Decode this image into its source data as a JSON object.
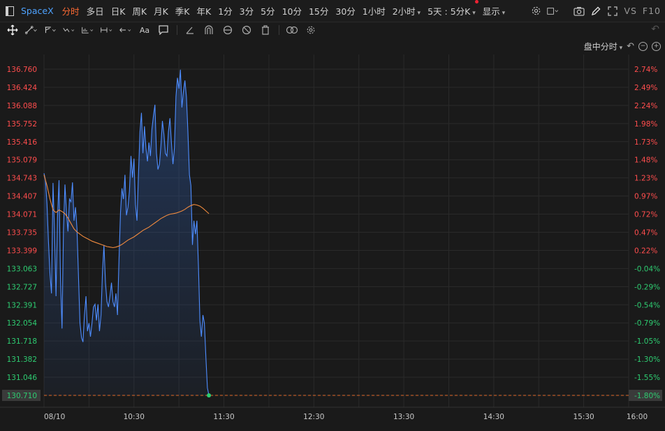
{
  "toolbar": {
    "symbol": "SpaceX",
    "intervals": [
      "分时",
      "多日",
      "日K",
      "周K",
      "月K",
      "季K",
      "年K",
      "1分",
      "3分",
      "5分",
      "10分",
      "15分",
      "30分",
      "1小时"
    ],
    "more_interval": "2小时",
    "multi_day": "5天 : 5分K",
    "display": "显示",
    "vs": "VS",
    "f10": "F10"
  },
  "period_bar": {
    "label": "盘中分时"
  },
  "colors": {
    "up": "#ff4d4d",
    "down": "#2ecc71",
    "price": "#4e8dff",
    "avg": "#f08a3e",
    "grid": "#2a2a2a",
    "background": "#1a1a1a"
  },
  "chart_data": {
    "type": "line",
    "title": "",
    "xlabel": "",
    "ylabel": "",
    "x_tick_labels": [
      "08/10",
      "10:30",
      "11:30",
      "12:30",
      "13:30",
      "14:30",
      "15:30",
      "16:00"
    ],
    "y_ticks_price": [
      "136.760",
      "136.424",
      "136.088",
      "135.752",
      "135.416",
      "135.079",
      "134.743",
      "134.407",
      "134.071",
      "133.735",
      "133.399",
      "133.063",
      "132.727",
      "132.391",
      "132.054",
      "131.718",
      "131.382",
      "131.046",
      "130.710"
    ],
    "y_ticks_pct": [
      "2.74%",
      "2.49%",
      "2.24%",
      "1.98%",
      "1.73%",
      "1.48%",
      "1.23%",
      "0.97%",
      "0.72%",
      "0.47%",
      "0.22%",
      "-0.04%",
      "-0.29%",
      "-0.54%",
      "-0.79%",
      "-1.05%",
      "-1.30%",
      "-1.55%",
      "-1.80%"
    ],
    "ylim": [
      130.71,
      136.76
    ],
    "reference_price": 133.11,
    "current_price": "130.710",
    "current_pct": "-1.80%",
    "time_range_minutes": [
      0,
      390
    ],
    "series": [
      {
        "name": "",
        "values": [
          [
            0,
            134.83
          ],
          [
            1,
            134.7
          ],
          [
            2,
            134.25
          ],
          [
            3,
            133.55
          ],
          [
            4,
            132.95
          ],
          [
            5,
            132.6
          ],
          [
            6,
            134.65
          ],
          [
            7,
            133.8
          ],
          [
            8,
            132.55
          ],
          [
            9,
            134.0
          ],
          [
            10,
            134.7
          ],
          [
            11,
            132.85
          ],
          [
            12,
            131.95
          ],
          [
            13,
            133.8
          ],
          [
            14,
            134.62
          ],
          [
            15,
            134.1
          ],
          [
            16,
            133.75
          ],
          [
            17,
            134.35
          ],
          [
            18,
            134.3
          ],
          [
            19,
            134.66
          ],
          [
            20,
            133.95
          ],
          [
            21,
            134.2
          ],
          [
            22,
            133.8
          ],
          [
            23,
            132.9
          ],
          [
            24,
            132.05
          ],
          [
            25,
            131.78
          ],
          [
            26,
            131.7
          ],
          [
            27,
            132.2
          ],
          [
            28,
            132.55
          ],
          [
            29,
            131.9
          ],
          [
            30,
            132.05
          ],
          [
            31,
            131.8
          ],
          [
            32,
            132.05
          ],
          [
            33,
            132.35
          ],
          [
            34,
            132.4
          ],
          [
            35,
            132.1
          ],
          [
            36,
            132.4
          ],
          [
            37,
            131.9
          ],
          [
            38,
            132.2
          ],
          [
            39,
            133.0
          ],
          [
            40,
            133.5
          ],
          [
            41,
            132.8
          ],
          [
            42,
            132.45
          ],
          [
            43,
            132.35
          ],
          [
            44,
            132.55
          ],
          [
            45,
            132.8
          ],
          [
            46,
            132.45
          ],
          [
            47,
            132.35
          ],
          [
            48,
            132.6
          ],
          [
            49,
            132.2
          ],
          [
            50,
            133.2
          ],
          [
            51,
            134.1
          ],
          [
            52,
            134.55
          ],
          [
            53,
            134.35
          ],
          [
            54,
            134.8
          ],
          [
            55,
            134.05
          ],
          [
            56,
            134.2
          ],
          [
            57,
            134.5
          ],
          [
            58,
            135.15
          ],
          [
            59,
            134.75
          ],
          [
            60,
            135.1
          ],
          [
            61,
            134.25
          ],
          [
            62,
            133.95
          ],
          [
            63,
            134.8
          ],
          [
            64,
            135.6
          ],
          [
            65,
            135.95
          ],
          [
            66,
            135.2
          ],
          [
            67,
            135.7
          ],
          [
            68,
            135.3
          ],
          [
            69,
            135.05
          ],
          [
            70,
            135.4
          ],
          [
            71,
            135.15
          ],
          [
            72,
            135.65
          ],
          [
            73,
            135.9
          ],
          [
            74,
            136.1
          ],
          [
            75,
            135.2
          ],
          [
            76,
            134.9
          ],
          [
            77,
            135.0
          ],
          [
            78,
            135.35
          ],
          [
            79,
            135.8
          ],
          [
            80,
            135.55
          ],
          [
            81,
            135.2
          ],
          [
            82,
            135.15
          ],
          [
            83,
            135.6
          ],
          [
            84,
            135.85
          ],
          [
            85,
            135.4
          ],
          [
            86,
            135.0
          ],
          [
            87,
            135.3
          ],
          [
            88,
            136.25
          ],
          [
            89,
            136.6
          ],
          [
            90,
            136.4
          ],
          [
            91,
            136.75
          ],
          [
            92,
            136.05
          ],
          [
            93,
            136.35
          ],
          [
            94,
            136.55
          ],
          [
            95,
            136.25
          ],
          [
            96,
            135.6
          ],
          [
            97,
            134.8
          ],
          [
            98,
            134.6
          ],
          [
            99,
            133.5
          ],
          [
            100,
            133.95
          ],
          [
            101,
            133.7
          ],
          [
            102,
            133.95
          ],
          [
            103,
            133.1
          ],
          [
            104,
            132.1
          ],
          [
            105,
            131.8
          ],
          [
            106,
            132.2
          ],
          [
            107,
            132.05
          ],
          [
            108,
            131.4
          ],
          [
            109,
            130.85
          ],
          [
            110,
            130.71
          ]
        ]
      },
      {
        "name": "",
        "values": [
          [
            0,
            134.8
          ],
          [
            2,
            134.6
          ],
          [
            4,
            134.35
          ],
          [
            6,
            134.15
          ],
          [
            8,
            134.1
          ],
          [
            10,
            134.15
          ],
          [
            12,
            134.12
          ],
          [
            14,
            134.08
          ],
          [
            16,
            134.0
          ],
          [
            18,
            133.9
          ],
          [
            20,
            133.8
          ],
          [
            22,
            133.74
          ],
          [
            24,
            133.7
          ],
          [
            26,
            133.66
          ],
          [
            28,
            133.63
          ],
          [
            30,
            133.6
          ],
          [
            32,
            133.57
          ],
          [
            34,
            133.55
          ],
          [
            36,
            133.53
          ],
          [
            38,
            133.51
          ],
          [
            40,
            133.49
          ],
          [
            42,
            133.47
          ],
          [
            44,
            133.46
          ],
          [
            46,
            133.45
          ],
          [
            48,
            133.46
          ],
          [
            50,
            133.48
          ],
          [
            52,
            133.51
          ],
          [
            54,
            133.55
          ],
          [
            56,
            133.59
          ],
          [
            58,
            133.62
          ],
          [
            60,
            133.65
          ],
          [
            62,
            133.69
          ],
          [
            64,
            133.73
          ],
          [
            66,
            133.77
          ],
          [
            68,
            133.8
          ],
          [
            70,
            133.83
          ],
          [
            72,
            133.87
          ],
          [
            74,
            133.91
          ],
          [
            76,
            133.95
          ],
          [
            78,
            133.99
          ],
          [
            80,
            134.02
          ],
          [
            82,
            134.05
          ],
          [
            84,
            134.07
          ],
          [
            86,
            134.08
          ],
          [
            88,
            134.09
          ],
          [
            90,
            134.11
          ],
          [
            92,
            134.13
          ],
          [
            94,
            134.16
          ],
          [
            96,
            134.2
          ],
          [
            98,
            134.23
          ],
          [
            100,
            134.25
          ],
          [
            102,
            134.24
          ],
          [
            104,
            134.22
          ],
          [
            106,
            134.18
          ],
          [
            108,
            134.13
          ],
          [
            110,
            134.08
          ]
        ]
      }
    ]
  }
}
